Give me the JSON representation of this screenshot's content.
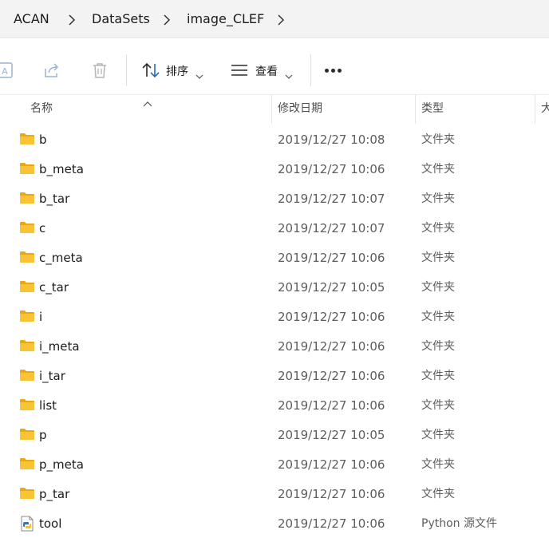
{
  "breadcrumb": {
    "items": [
      "ACAN",
      "DataSets",
      "image_CLEF"
    ]
  },
  "toolbar": {
    "sort_label": "排序",
    "view_label": "查看",
    "icons": [
      "ai-icon",
      "share-icon",
      "delete-icon",
      "sort-icon",
      "view-icon",
      "more-icon"
    ]
  },
  "columns": {
    "name": "名称",
    "date": "修改日期",
    "type": "类型",
    "size": "大"
  },
  "files": [
    {
      "name": "b",
      "date": "2019/12/27 10:08",
      "type": "文件夹",
      "icon": "folder-icon"
    },
    {
      "name": "b_meta",
      "date": "2019/12/27 10:06",
      "type": "文件夹",
      "icon": "folder-icon"
    },
    {
      "name": "b_tar",
      "date": "2019/12/27 10:07",
      "type": "文件夹",
      "icon": "folder-icon"
    },
    {
      "name": "c",
      "date": "2019/12/27 10:07",
      "type": "文件夹",
      "icon": "folder-icon"
    },
    {
      "name": "c_meta",
      "date": "2019/12/27 10:06",
      "type": "文件夹",
      "icon": "folder-icon"
    },
    {
      "name": "c_tar",
      "date": "2019/12/27 10:05",
      "type": "文件夹",
      "icon": "folder-icon"
    },
    {
      "name": "i",
      "date": "2019/12/27 10:06",
      "type": "文件夹",
      "icon": "folder-icon"
    },
    {
      "name": "i_meta",
      "date": "2019/12/27 10:06",
      "type": "文件夹",
      "icon": "folder-icon"
    },
    {
      "name": "i_tar",
      "date": "2019/12/27 10:06",
      "type": "文件夹",
      "icon": "folder-icon"
    },
    {
      "name": "list",
      "date": "2019/12/27 10:06",
      "type": "文件夹",
      "icon": "folder-icon"
    },
    {
      "name": "p",
      "date": "2019/12/27 10:05",
      "type": "文件夹",
      "icon": "folder-icon"
    },
    {
      "name": "p_meta",
      "date": "2019/12/27 10:06",
      "type": "文件夹",
      "icon": "folder-icon"
    },
    {
      "name": "p_tar",
      "date": "2019/12/27 10:06",
      "type": "文件夹",
      "icon": "folder-icon"
    },
    {
      "name": "tool",
      "date": "2019/12/27 10:06",
      "type": "Python 源文件",
      "icon": "python-file-icon"
    }
  ],
  "colors": {
    "folder": "#f8c436",
    "folder_dark": "#e9a90f",
    "header_bg": "#f3f3f3"
  }
}
